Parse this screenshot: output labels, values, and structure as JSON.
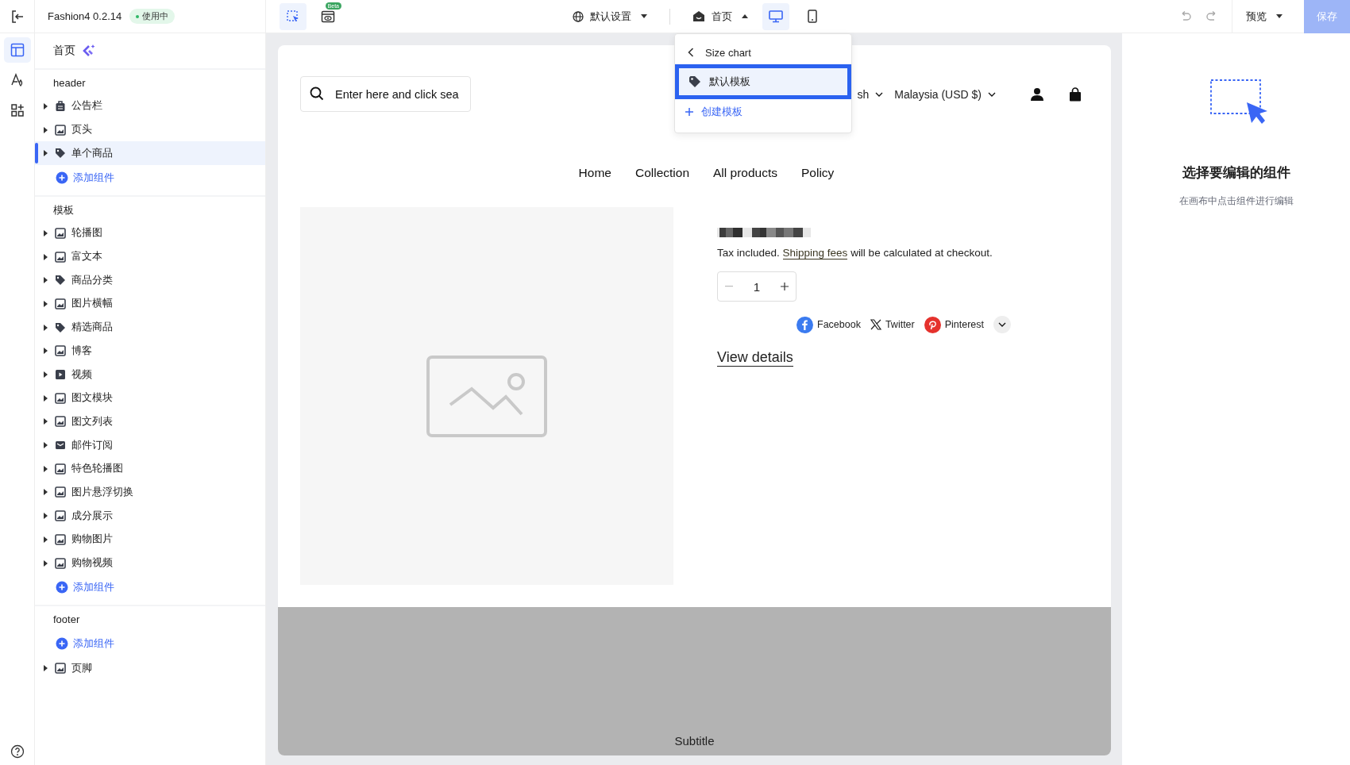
{
  "app": {
    "name": "Fashion4 0.2.14",
    "status": "使用中"
  },
  "rail": [
    {
      "selected": true
    },
    {
      "selected": false
    },
    {
      "selected": false
    }
  ],
  "toolbar": {
    "select_tool": {
      "selected": true
    },
    "beta": "Beta",
    "language": "默认设置",
    "page": "首页",
    "devices": [
      {
        "kind": "desktop",
        "selected": true
      },
      {
        "kind": "mobile",
        "selected": false
      }
    ],
    "preview": "预览",
    "save": "保存"
  },
  "tree": {
    "title": "首页",
    "sections": [
      {
        "label": "header",
        "items": [
          {
            "kind": "item",
            "label": "公告栏",
            "selected": false
          },
          {
            "kind": "item",
            "label": "页头",
            "selected": false
          },
          {
            "kind": "item",
            "label": "单个商品",
            "selected": true
          },
          {
            "kind": "add",
            "label": "添加组件"
          }
        ]
      },
      {
        "label": "模板",
        "items": [
          {
            "kind": "item",
            "label": "轮播图",
            "selected": false
          },
          {
            "kind": "item",
            "label": "富文本",
            "selected": false
          },
          {
            "kind": "item",
            "label": "商品分类",
            "selected": false
          },
          {
            "kind": "item",
            "label": "图片横幅",
            "selected": false
          },
          {
            "kind": "item",
            "label": "精选商品",
            "selected": false
          },
          {
            "kind": "item",
            "label": "博客",
            "selected": false
          },
          {
            "kind": "item",
            "label": "视频",
            "selected": false
          },
          {
            "kind": "item",
            "label": "图文模块",
            "selected": false
          },
          {
            "kind": "item",
            "label": "图文列表",
            "selected": false
          },
          {
            "kind": "item",
            "label": "邮件订阅",
            "selected": false
          },
          {
            "kind": "item",
            "label": "特色轮播图",
            "selected": false
          },
          {
            "kind": "item",
            "label": "图片悬浮切换",
            "selected": false
          },
          {
            "kind": "item",
            "label": "成分展示",
            "selected": false
          },
          {
            "kind": "item",
            "label": "购物图片",
            "selected": false
          },
          {
            "kind": "item",
            "label": "购物视频",
            "selected": false
          },
          {
            "kind": "add",
            "label": "添加组件"
          }
        ]
      },
      {
        "label": "footer",
        "items": [
          {
            "kind": "add",
            "label": "添加组件"
          },
          {
            "kind": "item",
            "label": "页脚",
            "selected": false
          }
        ]
      }
    ]
  },
  "dropdown": {
    "back": "Size chart",
    "items": [
      {
        "label": "默认模板",
        "selected": true
      }
    ],
    "create": "创建模板"
  },
  "store": {
    "search": {
      "placeholder": "Enter here and click sea"
    },
    "language": "sh",
    "currency": "Malaysia (USD $)",
    "nav": [
      "Home",
      "Collection",
      "All products",
      "Policy"
    ],
    "product": {
      "tax_note": {
        "before": "Tax included.",
        "link": "Shipping fees",
        "after": "will be calculated at checkout."
      },
      "quantity": "1",
      "share": [
        {
          "kind": "facebook",
          "label": "Facebook"
        },
        {
          "kind": "x",
          "label": "Twitter"
        },
        {
          "kind": "pinterest",
          "label": "Pinterest"
        }
      ],
      "view_details": "View details"
    },
    "footer": {
      "subtitle": "Subtitle"
    }
  },
  "inspector": {
    "title": "选择要编辑的组件",
    "hint": "在画布中点击组件进行编辑"
  }
}
